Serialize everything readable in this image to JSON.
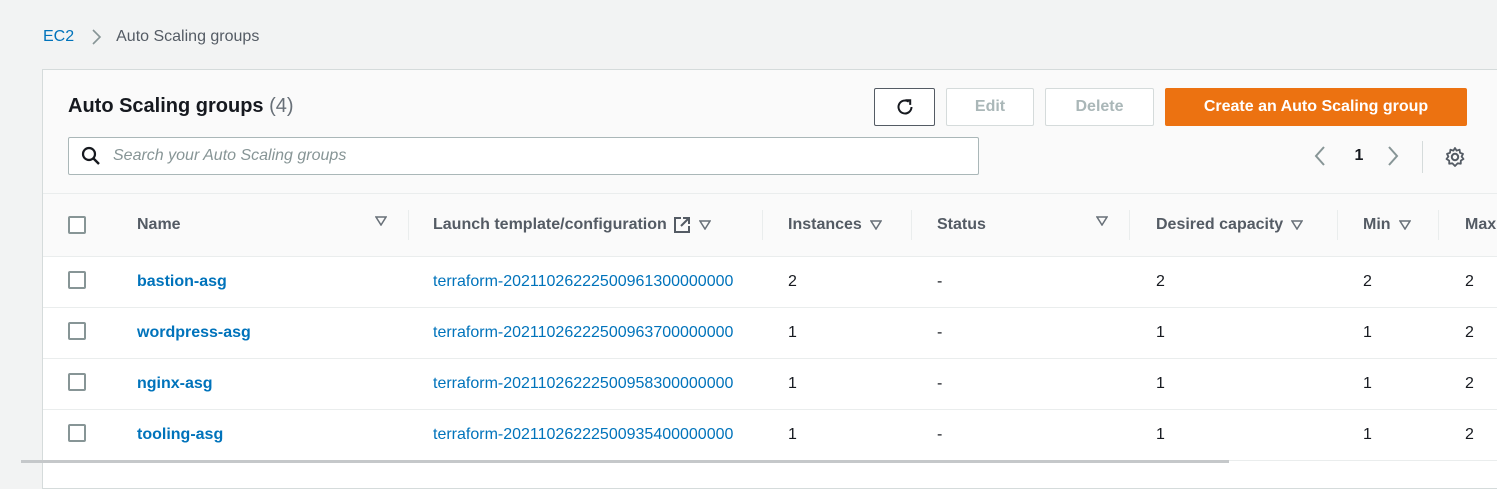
{
  "breadcrumb": {
    "root": "EC2",
    "current": "Auto Scaling groups"
  },
  "header": {
    "title": "Auto Scaling groups",
    "count": "(4)",
    "edit_label": "Edit",
    "delete_label": "Delete",
    "create_label": "Create an Auto Scaling group"
  },
  "search": {
    "placeholder": "Search your Auto Scaling groups",
    "value": ""
  },
  "pagination": {
    "current_page": "1"
  },
  "table": {
    "columns": [
      "Name",
      "Launch template/configuration",
      "Instances",
      "Status",
      "Desired capacity",
      "Min",
      "Max"
    ],
    "rows": [
      {
        "name": "bastion-asg",
        "launch_template": "terraform-20211026222500961300000000",
        "instances": "2",
        "status": "-",
        "desired": "2",
        "min": "2",
        "max": "2"
      },
      {
        "name": "wordpress-asg",
        "launch_template": "terraform-20211026222500963700000000",
        "instances": "1",
        "status": "-",
        "desired": "1",
        "min": "1",
        "max": "2"
      },
      {
        "name": "nginx-asg",
        "launch_template": "terraform-20211026222500958300000000",
        "instances": "1",
        "status": "-",
        "desired": "1",
        "min": "1",
        "max": "2"
      },
      {
        "name": "tooling-asg",
        "launch_template": "terraform-20211026222500935400000000",
        "instances": "1",
        "status": "-",
        "desired": "1",
        "min": "1",
        "max": "2"
      }
    ]
  },
  "colors": {
    "link": "#0073bb",
    "primary": "#ec7211",
    "text": "#16191f",
    "muted": "#545b64",
    "disabled": "#aab7b8"
  },
  "icons": [
    "chevron-right-icon",
    "refresh-icon",
    "search-icon",
    "chevron-left-icon",
    "settings-icon",
    "sort-down-icon",
    "external-link-icon"
  ]
}
